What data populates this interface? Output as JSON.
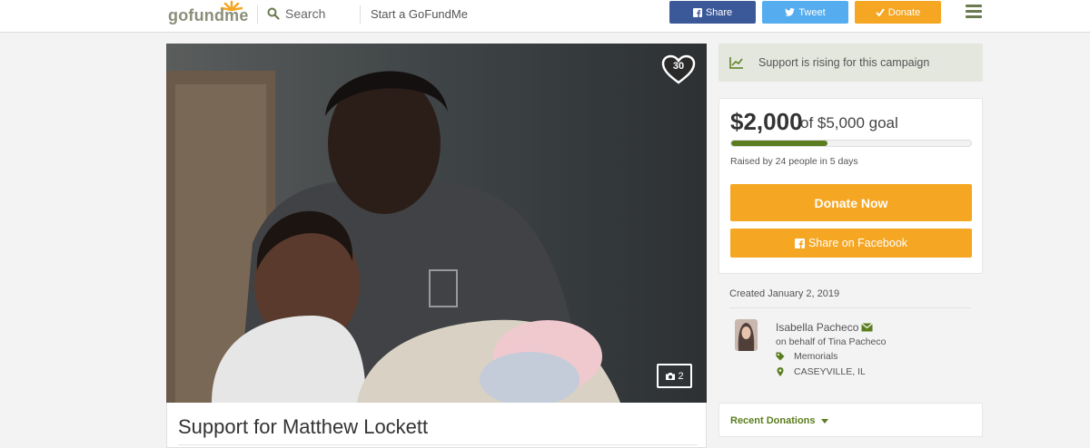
{
  "colors": {
    "brand_green": "#5b7d1f",
    "orange": "#f5a623",
    "facebook": "#3b5998",
    "twitter": "#55acee"
  },
  "header": {
    "logo": "gofundme",
    "search_label": "Search",
    "start_link": "Start a GoFundMe",
    "share_label": "Share",
    "tweet_label": "Tweet",
    "donate_label": "Donate"
  },
  "campaign": {
    "heart_count": "30",
    "photo_count": "2",
    "title": "Support for Matthew Lockett"
  },
  "sidebar": {
    "rising_text": "Support is rising for this campaign",
    "amount_raised": "$2,000",
    "goal_text": "of $5,000 goal",
    "progress_fraction": 0.4,
    "raised_by": "Raised by 24 people in 5 days",
    "donate_now": "Donate Now",
    "share_facebook": "Share on Facebook",
    "created": "Created January 2, 2019",
    "organizer_name": "Isabella Pacheco",
    "on_behalf": "on behalf of Tina Pacheco",
    "category": "Memorials",
    "location": "CASEYVILLE, IL",
    "recent_donations": "Recent Donations"
  }
}
